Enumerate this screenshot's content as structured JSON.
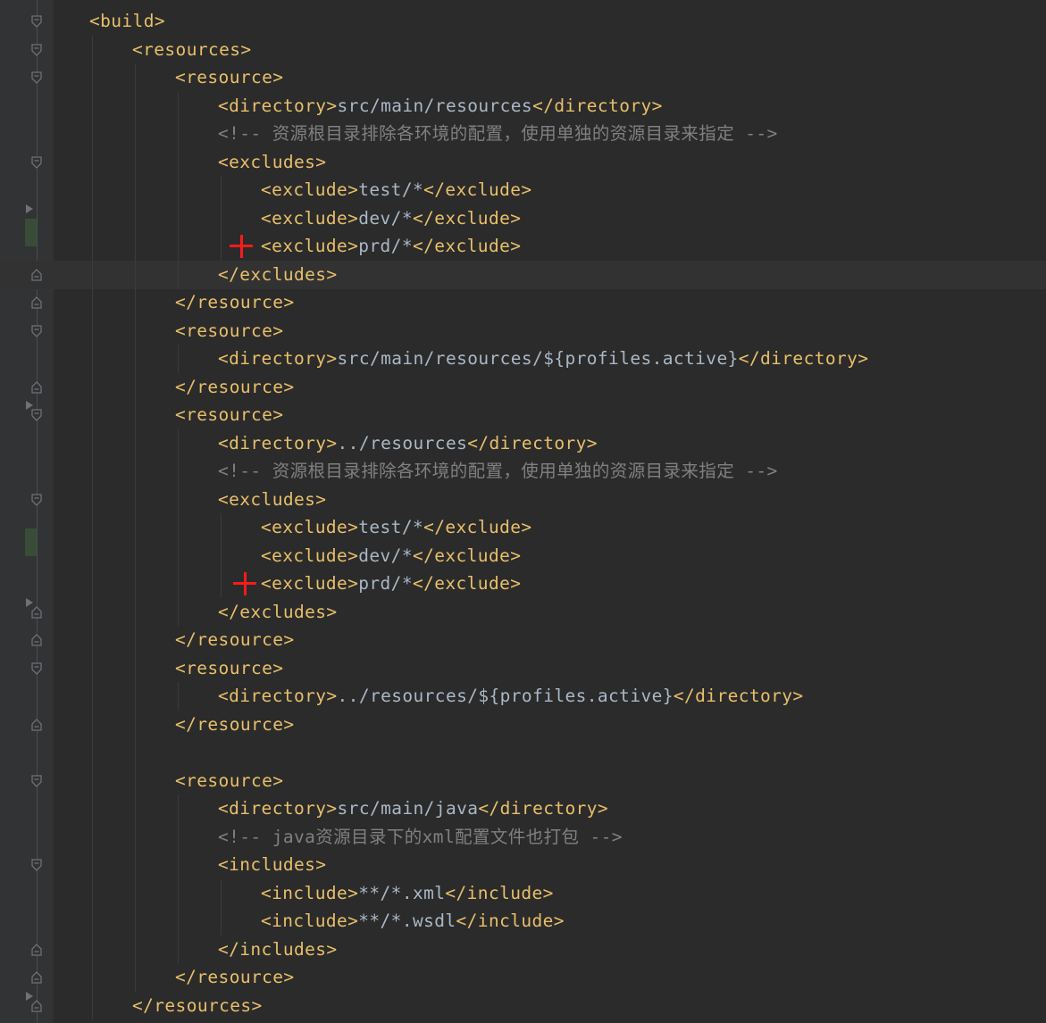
{
  "editor": {
    "language": "xml",
    "colors": {
      "background": "#2b2b2b",
      "tag": "#e8bf6a",
      "text": "#a9b7c6",
      "comment": "#808080",
      "annotation_plus": "#ff1a1a"
    },
    "lines": [
      {
        "parts": [
          {
            "t": "tag",
            "v": "<build>"
          }
        ]
      },
      {
        "parts": [
          {
            "t": "tag",
            "v": "<resources>"
          }
        ]
      },
      {
        "parts": [
          {
            "t": "tag",
            "v": "<resource>"
          }
        ]
      },
      {
        "parts": [
          {
            "t": "tag",
            "v": "<directory>"
          },
          {
            "t": "txt",
            "v": "src/main/resources"
          },
          {
            "t": "tag",
            "v": "</directory>"
          }
        ]
      },
      {
        "parts": [
          {
            "t": "cmt",
            "v": "<!-- 资源根目录排除各环境的配置，使用单独的资源目录来指定 -->"
          }
        ]
      },
      {
        "parts": [
          {
            "t": "tag",
            "v": "<excludes>"
          }
        ]
      },
      {
        "parts": [
          {
            "t": "tag",
            "v": "<exclude>"
          },
          {
            "t": "txt",
            "v": "test/*"
          },
          {
            "t": "tag",
            "v": "</exclude>"
          }
        ]
      },
      {
        "parts": [
          {
            "t": "tag",
            "v": "<exclude>"
          },
          {
            "t": "txt",
            "v": "dev/*"
          },
          {
            "t": "tag",
            "v": "</exclude>"
          }
        ]
      },
      {
        "parts": [
          {
            "t": "tag",
            "v": "<exclude>"
          },
          {
            "t": "txt",
            "v": "prd/*"
          },
          {
            "t": "tag",
            "v": "</exclude>"
          }
        ]
      },
      {
        "parts": [
          {
            "t": "tag",
            "v": "</excludes>"
          }
        ]
      },
      {
        "parts": [
          {
            "t": "tag",
            "v": "</resource>"
          }
        ]
      },
      {
        "parts": [
          {
            "t": "tag",
            "v": "<resource>"
          }
        ]
      },
      {
        "parts": [
          {
            "t": "tag",
            "v": "<directory>"
          },
          {
            "t": "txt",
            "v": "src/main/resources/${profiles.active}"
          },
          {
            "t": "tag",
            "v": "</directory>"
          }
        ]
      },
      {
        "parts": [
          {
            "t": "tag",
            "v": "</resource>"
          }
        ]
      },
      {
        "parts": [
          {
            "t": "tag",
            "v": "<resource>"
          }
        ]
      },
      {
        "parts": [
          {
            "t": "tag",
            "v": "<directory>"
          },
          {
            "t": "txt",
            "v": "../resources"
          },
          {
            "t": "tag",
            "v": "</directory>"
          }
        ]
      },
      {
        "parts": [
          {
            "t": "cmt",
            "v": "<!-- 资源根目录排除各环境的配置，使用单独的资源目录来指定 -->"
          }
        ]
      },
      {
        "parts": [
          {
            "t": "tag",
            "v": "<excludes>"
          }
        ]
      },
      {
        "parts": [
          {
            "t": "tag",
            "v": "<exclude>"
          },
          {
            "t": "txt",
            "v": "test/*"
          },
          {
            "t": "tag",
            "v": "</exclude>"
          }
        ]
      },
      {
        "parts": [
          {
            "t": "tag",
            "v": "<exclude>"
          },
          {
            "t": "txt",
            "v": "dev/*"
          },
          {
            "t": "tag",
            "v": "</exclude>"
          }
        ]
      },
      {
        "parts": [
          {
            "t": "tag",
            "v": "<exclude>"
          },
          {
            "t": "txt",
            "v": "prd/*"
          },
          {
            "t": "tag",
            "v": "</exclude>"
          }
        ]
      },
      {
        "parts": [
          {
            "t": "tag",
            "v": "</excludes>"
          }
        ]
      },
      {
        "parts": [
          {
            "t": "tag",
            "v": "</resource>"
          }
        ]
      },
      {
        "parts": [
          {
            "t": "tag",
            "v": "<resource>"
          }
        ]
      },
      {
        "parts": [
          {
            "t": "tag",
            "v": "<directory>"
          },
          {
            "t": "txt",
            "v": "../resources/${profiles.active}"
          },
          {
            "t": "tag",
            "v": "</directory>"
          }
        ]
      },
      {
        "parts": [
          {
            "t": "tag",
            "v": "</resource>"
          }
        ]
      },
      {
        "parts": []
      },
      {
        "parts": [
          {
            "t": "tag",
            "v": "<resource>"
          }
        ]
      },
      {
        "parts": [
          {
            "t": "tag",
            "v": "<directory>"
          },
          {
            "t": "txt",
            "v": "src/main/java"
          },
          {
            "t": "tag",
            "v": "</directory>"
          }
        ]
      },
      {
        "parts": [
          {
            "t": "cmt",
            "v": "<!-- java资源目录下的xml配置文件也打包 -->"
          }
        ]
      },
      {
        "parts": [
          {
            "t": "tag",
            "v": "<includes>"
          }
        ]
      },
      {
        "parts": [
          {
            "t": "tag",
            "v": "<include>"
          },
          {
            "t": "txt",
            "v": "**/*.xml"
          },
          {
            "t": "tag",
            "v": "</include>"
          }
        ]
      },
      {
        "parts": [
          {
            "t": "tag",
            "v": "<include>"
          },
          {
            "t": "txt",
            "v": "**/*.wsdl"
          },
          {
            "t": "tag",
            "v": "</include>"
          }
        ]
      },
      {
        "parts": [
          {
            "t": "tag",
            "v": "</includes>"
          }
        ]
      },
      {
        "parts": [
          {
            "t": "tag",
            "v": "</resource>"
          }
        ]
      },
      {
        "parts": [
          {
            "t": "tag",
            "v": "</resources>"
          }
        ]
      }
    ]
  }
}
